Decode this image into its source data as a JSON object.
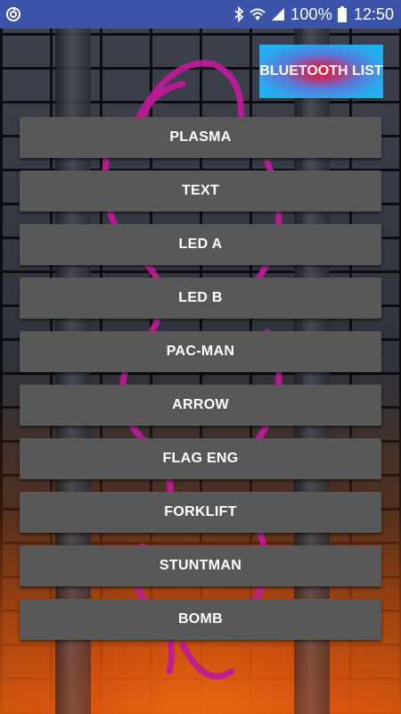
{
  "status_bar": {
    "battery_percent": "100%",
    "time": "12:50",
    "icons": [
      "sync-icon",
      "bluetooth-icon",
      "wifi-icon",
      "signal-icon",
      "battery-icon"
    ],
    "background_color": "#3b53a8"
  },
  "bluetooth_button": {
    "label": "BLUETOOTH LIST"
  },
  "menu": {
    "items": [
      {
        "label": "PLASMA"
      },
      {
        "label": "TEXT"
      },
      {
        "label": "LED A"
      },
      {
        "label": "LED B"
      },
      {
        "label": "PAC-MAN"
      },
      {
        "label": "ARROW"
      },
      {
        "label": "FLAG ENG"
      },
      {
        "label": "FORKLIFT"
      },
      {
        "label": "STUNTMAN"
      },
      {
        "label": "BOMB"
      }
    ],
    "button_color": "#585858"
  },
  "colors": {
    "accent_magenta": "#c2199a",
    "fire_orange": "#e05a10"
  }
}
